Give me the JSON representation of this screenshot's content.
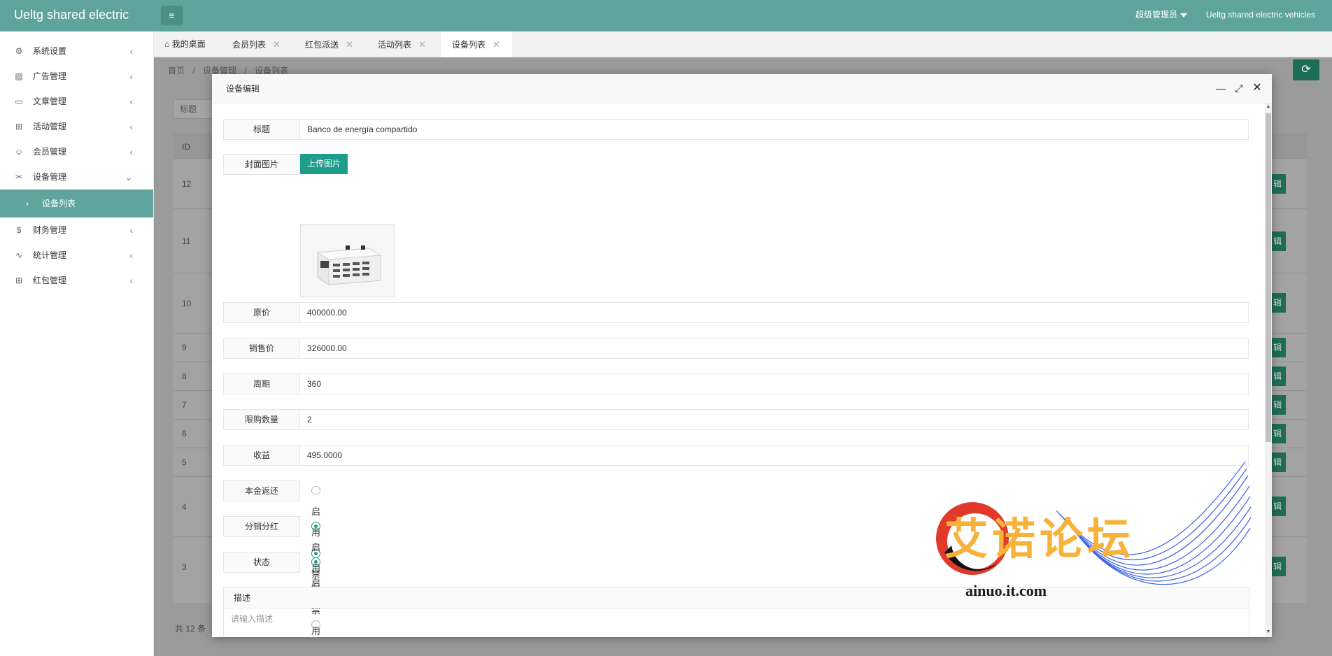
{
  "header": {
    "logo": "Ueltg shared electric",
    "menu_icon": "hamburger-icon",
    "admin_label": "超级管理员",
    "site_name": "Ueltg shared electric vehicles"
  },
  "sidebar": {
    "items": [
      {
        "label": "系统设置",
        "icon": "gear-icon"
      },
      {
        "label": "广告管理",
        "icon": "image-icon"
      },
      {
        "label": "文章管理",
        "icon": "book-icon"
      },
      {
        "label": "活动管理",
        "icon": "gift-icon"
      },
      {
        "label": "会员管理",
        "icon": "user-icon"
      },
      {
        "label": "设备管理",
        "icon": "tools-icon"
      },
      {
        "label": "设备列表",
        "icon": "chevron-right-icon"
      },
      {
        "label": "财务管理",
        "icon": "dollar-icon"
      },
      {
        "label": "统计管理",
        "icon": "pulse-icon"
      },
      {
        "label": "红包管理",
        "icon": "gift-icon"
      }
    ]
  },
  "tabs": [
    {
      "label": "我的桌面"
    },
    {
      "label": "会员列表"
    },
    {
      "label": "红包派送"
    },
    {
      "label": "活动列表"
    },
    {
      "label": "设备列表"
    }
  ],
  "breadcrumb": {
    "home": "首页",
    "sep": "/",
    "parent": "设备管理",
    "current": "设备列表"
  },
  "background": {
    "search_label": "标题",
    "id_header": "ID",
    "ids": [
      "12",
      "11",
      "10",
      "9",
      "8",
      "7",
      "6",
      "5",
      "4",
      "3"
    ],
    "edit_label": "辑",
    "total": "共 12 条"
  },
  "dialog": {
    "title": "设备编辑",
    "fields": {
      "title_label": "标题",
      "title_value": "Banco de energía compartido",
      "cover_label": "封面图片",
      "upload_label": "上传图片",
      "orig_price_label": "原价",
      "orig_price_value": "400000.00",
      "sale_price_label": "销售价",
      "sale_price_value": "326000.00",
      "period_label": "周期",
      "period_value": "360",
      "limit_label": "限购数量",
      "limit_value": "2",
      "income_label": "收益",
      "income_value": "495.0000",
      "principal_label": "本金返还",
      "dividend_label": "分销分红",
      "status_label": "状态",
      "enable": "启用",
      "disable": "禁用",
      "desc_label": "描述",
      "desc_placeholder": "请输入描述"
    },
    "radios": {
      "principal": "禁用",
      "dividend": "启用",
      "status": "启用"
    }
  },
  "watermark": {
    "text": "艾诺论坛",
    "url": "ainuo.it.com"
  },
  "colors": {
    "primary": "#5ea49c",
    "button": "#1e9e8a",
    "watermark_orange": "#f7b23a",
    "watermark_blue": "#1a47e0"
  }
}
